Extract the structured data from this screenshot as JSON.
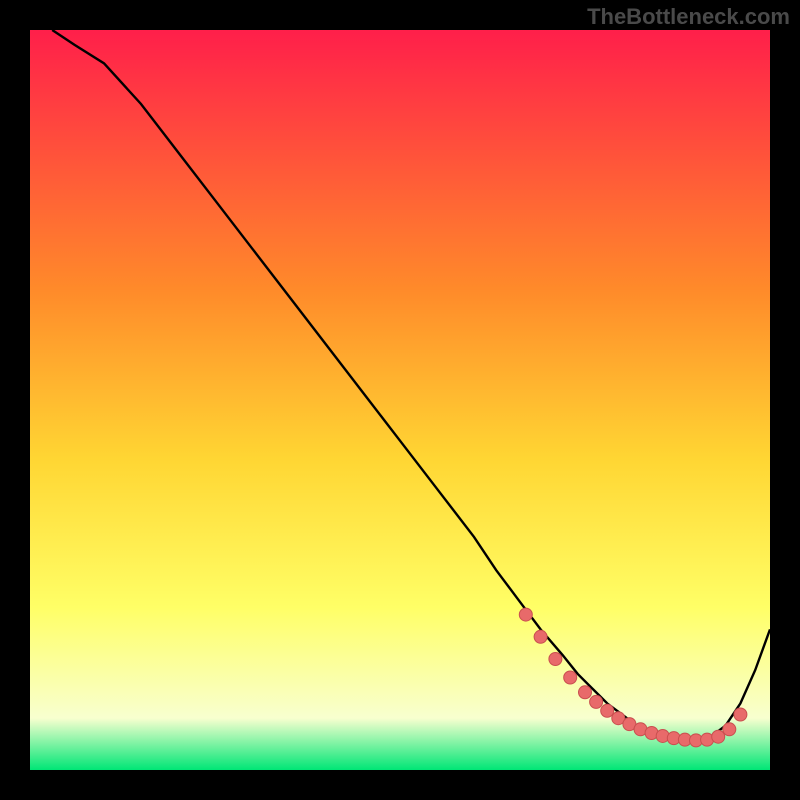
{
  "watermark": "TheBottleneck.com",
  "colors": {
    "gradient_top": "#ff1f4a",
    "gradient_mid_upper": "#ff8a2a",
    "gradient_mid": "#ffd633",
    "gradient_mid_lower": "#ffff66",
    "gradient_pale": "#f8ffcf",
    "gradient_bottom": "#00e676",
    "curve": "#000000",
    "marker_fill": "#e86a6a",
    "marker_stroke": "#c94f4f"
  },
  "chart_data": {
    "type": "line",
    "title": "",
    "xlabel": "",
    "ylabel": "",
    "xlim": [
      0,
      100
    ],
    "ylim": [
      0,
      100
    ],
    "series": [
      {
        "name": "curve",
        "x": [
          3,
          6,
          10,
          15,
          20,
          25,
          30,
          35,
          40,
          45,
          50,
          55,
          60,
          63,
          66,
          69,
          72,
          74,
          76,
          78,
          80,
          82,
          84,
          86,
          88,
          90,
          92,
          94,
          96,
          98,
          100
        ],
        "y": [
          100,
          98,
          95.5,
          90,
          83.5,
          77,
          70.5,
          64,
          57.5,
          51,
          44.5,
          38,
          31.5,
          27,
          23,
          19,
          15.5,
          13,
          11,
          9,
          7.5,
          6,
          5,
          4.3,
          4,
          4,
          4.5,
          6,
          9,
          13.5,
          19
        ]
      }
    ],
    "markers": {
      "name": "highlighted-range",
      "x": [
        67,
        69,
        71,
        73,
        75,
        76.5,
        78,
        79.5,
        81,
        82.5,
        84,
        85.5,
        87,
        88.5,
        90,
        91.5,
        93,
        94.5,
        96
      ],
      "y": [
        21,
        18,
        15,
        12.5,
        10.5,
        9.2,
        8,
        7,
        6.2,
        5.5,
        5,
        4.6,
        4.3,
        4.1,
        4,
        4.1,
        4.5,
        5.5,
        7.5
      ]
    }
  }
}
